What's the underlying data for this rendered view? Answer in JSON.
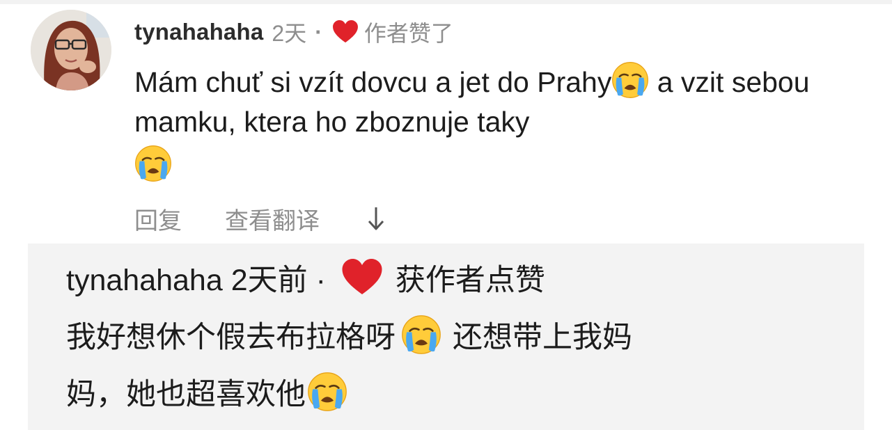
{
  "comment": {
    "username": "tynahahaha",
    "time": "2天",
    "separator": "·",
    "liked_label": "作者赞了",
    "text_part1": "Mám chuť si vzít dovcu a jet do Prahy",
    "text_part2": " a vzit sebou mamku, ktera ho zboznuje taky",
    "emoji_name": "loudly-crying-face-icon",
    "actions": {
      "reply_label": "回复",
      "translate_label": "查看翻译",
      "arrow": "↓"
    }
  },
  "translation": {
    "header": "tynahahaha 2天前 ·",
    "liked_label": "获作者点赞",
    "text_line2_a": "我好想休个假去布拉格呀",
    "text_line2_b": "还想带上我妈",
    "text_line3": "妈，她也超喜欢他"
  },
  "colors": {
    "heart": "#e0222a",
    "muted_text": "#8e8e8e",
    "panel_bg": "#f3f3f3"
  }
}
